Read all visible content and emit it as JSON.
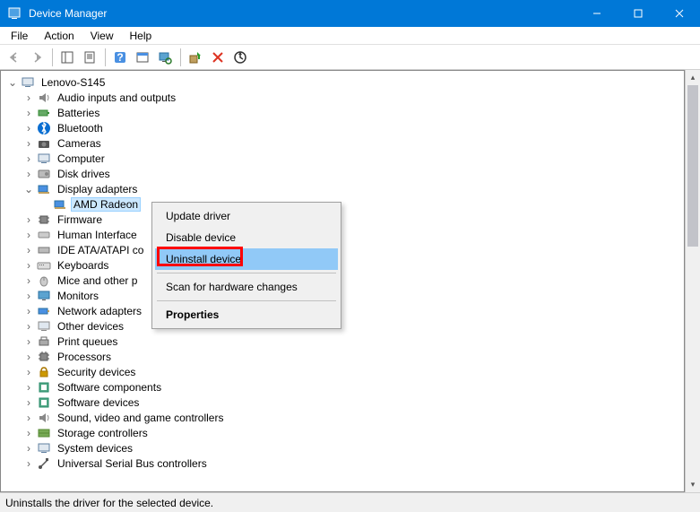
{
  "window": {
    "title": "Device Manager"
  },
  "menubar": {
    "file": "File",
    "action": "Action",
    "view": "View",
    "help": "Help"
  },
  "tree": {
    "root": "Lenovo-S145",
    "categories": {
      "audio": "Audio inputs and outputs",
      "batteries": "Batteries",
      "bluetooth": "Bluetooth",
      "cameras": "Cameras",
      "computer": "Computer",
      "disk": "Disk drives",
      "display": "Display adapters",
      "firmware": "Firmware",
      "hid": "Human Interface",
      "ide": "IDE ATA/ATAPI co",
      "keyboards": "Keyboards",
      "mice": "Mice and other p",
      "monitors": "Monitors",
      "network": "Network adapters",
      "other": "Other devices",
      "print": "Print queues",
      "processors": "Processors",
      "security": "Security devices",
      "softcomp": "Software components",
      "softdev": "Software devices",
      "sound": "Sound, video and game controllers",
      "storage": "Storage controllers",
      "system": "System devices",
      "usb": "Universal Serial Bus controllers"
    },
    "child": {
      "amd": "AMD Radeon"
    }
  },
  "context_menu": {
    "update": "Update driver",
    "disable": "Disable device",
    "uninstall": "Uninstall device",
    "scan": "Scan for hardware changes",
    "properties": "Properties"
  },
  "status": "Uninstalls the driver for the selected device."
}
